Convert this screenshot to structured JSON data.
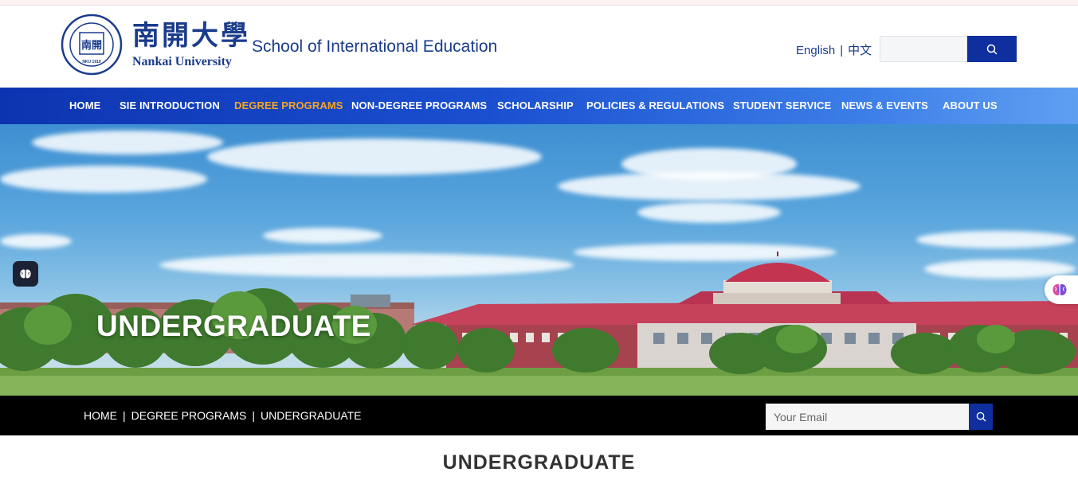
{
  "header": {
    "seal_text": "SCHOOL OF INTERNATIONAL EDUCATION",
    "seal_center": "南開",
    "seal_year": "NKU 1919",
    "university_cn": "南開大學",
    "university_en": "Nankai University",
    "school_name": "School of International Education",
    "lang_english": "English",
    "lang_separator": "|",
    "lang_chinese": "中文",
    "search_value": ""
  },
  "nav": {
    "items": [
      {
        "label": "HOME",
        "active": false
      },
      {
        "label": "SIE INTRODUCTION",
        "active": false
      },
      {
        "label": "DEGREE PROGRAMS",
        "active": true
      },
      {
        "label": "NON-DEGREE PROGRAMS",
        "active": false
      },
      {
        "label": "SCHOLARSHIP",
        "active": false
      },
      {
        "label": "POLICIES & REGULATIONS",
        "active": false
      },
      {
        "label": "STUDENT SERVICE",
        "active": false
      },
      {
        "label": "NEWS & EVENTS",
        "active": false
      },
      {
        "label": "ABOUT US",
        "active": false
      }
    ]
  },
  "hero": {
    "title": "UNDERGRADUATE"
  },
  "breadcrumb": {
    "items": [
      "HOME",
      "DEGREE PROGRAMS",
      "UNDERGRADUATE"
    ],
    "separator": "|"
  },
  "subscribe": {
    "placeholder": "Your Email"
  },
  "page": {
    "heading": "UNDERGRADUATE"
  },
  "colors": {
    "brand_blue": "#1a3c8c",
    "nav_active": "#f5a623",
    "button_blue": "#0f2f9e"
  },
  "icons": {
    "search": "search-icon",
    "brain_left": "brain-icon",
    "brain_right": "brain-icon"
  }
}
